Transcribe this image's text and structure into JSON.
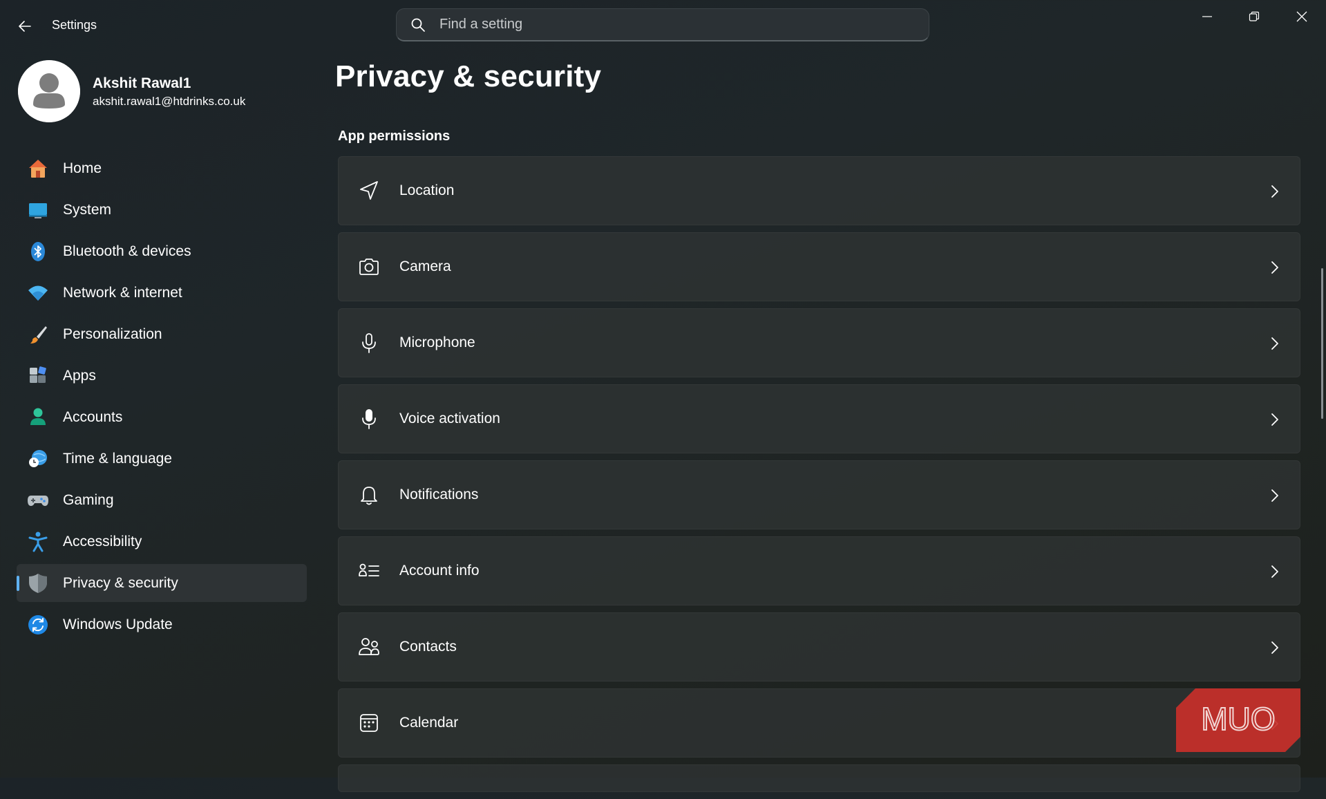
{
  "app": {
    "title": "Settings"
  },
  "search": {
    "placeholder": "Find a setting"
  },
  "user": {
    "name": "Akshit Rawal1",
    "email": "akshit.rawal1@htdrinks.co.uk"
  },
  "nav": {
    "items": [
      {
        "label": "Home",
        "icon": "home-icon"
      },
      {
        "label": "System",
        "icon": "monitor-icon"
      },
      {
        "label": "Bluetooth & devices",
        "icon": "bluetooth-icon"
      },
      {
        "label": "Network & internet",
        "icon": "wifi-icon"
      },
      {
        "label": "Personalization",
        "icon": "brush-icon"
      },
      {
        "label": "Apps",
        "icon": "apps-icon"
      },
      {
        "label": "Accounts",
        "icon": "person-icon"
      },
      {
        "label": "Time & language",
        "icon": "globe-clock-icon"
      },
      {
        "label": "Gaming",
        "icon": "gamepad-icon"
      },
      {
        "label": "Accessibility",
        "icon": "accessibility-icon"
      },
      {
        "label": "Privacy & security",
        "icon": "shield-icon",
        "selected": true
      },
      {
        "label": "Windows Update",
        "icon": "update-icon"
      }
    ]
  },
  "main": {
    "title": "Privacy & security",
    "section": "App permissions",
    "rows": [
      {
        "label": "Location",
        "icon": "location-icon"
      },
      {
        "label": "Camera",
        "icon": "camera-icon"
      },
      {
        "label": "Microphone",
        "icon": "microphone-icon"
      },
      {
        "label": "Voice activation",
        "icon": "voice-mic-icon"
      },
      {
        "label": "Notifications",
        "icon": "bell-icon"
      },
      {
        "label": "Account info",
        "icon": "account-info-icon"
      },
      {
        "label": "Contacts",
        "icon": "contacts-icon"
      },
      {
        "label": "Calendar",
        "icon": "calendar-icon"
      }
    ]
  },
  "watermark": {
    "text": "MUO"
  },
  "colors": {
    "accent": "#5fb2f2",
    "background": "#1f2629",
    "row": "#303434",
    "selected": "#2e3335"
  }
}
